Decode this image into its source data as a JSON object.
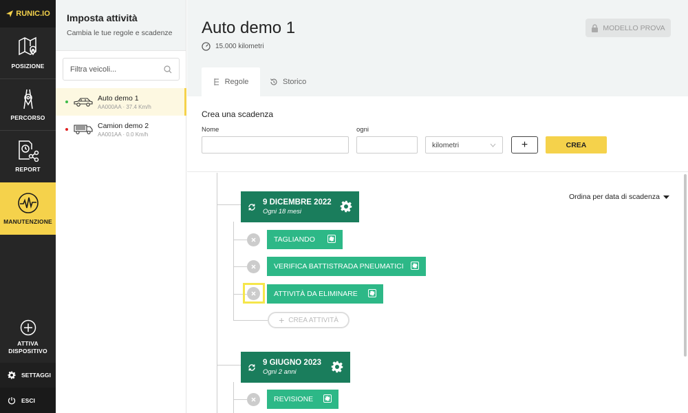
{
  "brand": {
    "logo": "RUNIC.IO",
    "accent": "#f5d24b",
    "green_dark": "#1a7d5c",
    "green": "#2db887"
  },
  "nav": {
    "posizione": "POSIZIONE",
    "percorso": "PERCORSO",
    "report": "REPORT",
    "manutenzione": "MANUTENZIONE",
    "attiva1": "ATTIVA",
    "attiva2": "DISPOSITIVO",
    "settaggi": "SETTAGGI",
    "esci": "ESCI"
  },
  "panel": {
    "title": "Imposta attività",
    "subtitle": "Cambia le tue regole e scadenze",
    "search_placeholder": "Filtra veicoli...",
    "vehicles": [
      {
        "name": "Auto demo 1",
        "meta": "AA000AA · 37.4 Km/h",
        "status_color": "#3dbb4a",
        "selected": true
      },
      {
        "name": "Camion demo 2",
        "meta": "AA001AA · 0.0 Km/h",
        "status_color": "#e02020",
        "selected": false
      }
    ]
  },
  "main": {
    "title": "Auto demo 1",
    "odometer": "15.000 kilometri",
    "modello_button": "MODELLO PROVA",
    "tabs": {
      "regole": "Regole",
      "storico": "Storico"
    },
    "crea": {
      "title": "Crea una scadenza",
      "nome_label": "Nome",
      "ogni_label": "ogni",
      "nome_value": "",
      "ogni_value": "",
      "unit_selected": "kilometri",
      "plus_label": "+",
      "crea_button": "CREA"
    },
    "sort_label": "Ordina per data di scadenza",
    "deadlines": [
      {
        "date": "9 DICEMBRE 2022",
        "every": "Ogni 18 mesi",
        "tasks": [
          "TAGLIANDO",
          "VERIFICA BATTISTRADA PNEUMATICI",
          "ATTIVITÀ DA ELIMINARE"
        ],
        "add_label": "CREA ATTIVITÀ"
      },
      {
        "date": "9 GIUGNO 2023",
        "every": "Ogni 2 anni",
        "tasks": [
          "REVISIONE"
        ]
      }
    ]
  }
}
